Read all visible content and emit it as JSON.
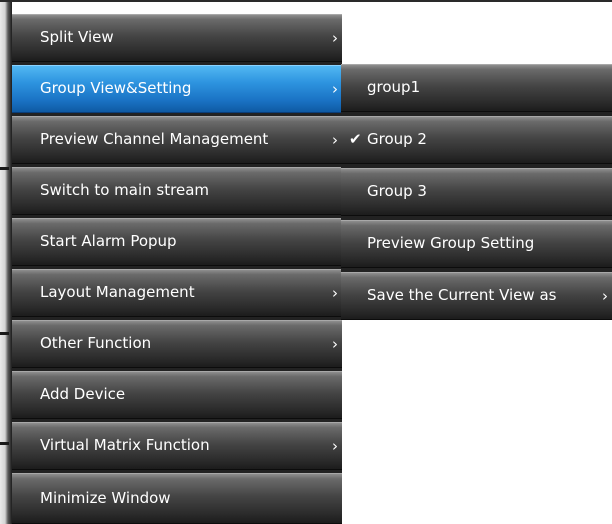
{
  "main_menu": {
    "items": [
      {
        "label": "Split View",
        "has_submenu": true
      },
      {
        "label": "Group View&Setting",
        "has_submenu": true,
        "selected": true
      },
      {
        "label": "Preview Channel Management",
        "has_submenu": true
      },
      {
        "label": "Switch to main stream",
        "has_submenu": false
      },
      {
        "label": "Start Alarm Popup",
        "has_submenu": false
      },
      {
        "label": "Layout Management",
        "has_submenu": true
      },
      {
        "label": "Other Function",
        "has_submenu": true
      },
      {
        "label": "Add Device",
        "has_submenu": false
      },
      {
        "label": "Virtual Matrix Function",
        "has_submenu": true
      },
      {
        "label": "Minimize Window",
        "has_submenu": false
      }
    ]
  },
  "sub_menu": {
    "items": [
      {
        "label": "group1",
        "checked": false,
        "has_submenu": false
      },
      {
        "label": "Group 2",
        "checked": true,
        "has_submenu": false
      },
      {
        "label": "Group 3",
        "checked": false,
        "has_submenu": false
      },
      {
        "label": "Preview Group Setting",
        "checked": false,
        "has_submenu": false
      },
      {
        "label": "Save the Current View as",
        "checked": false,
        "has_submenu": true
      }
    ]
  },
  "glyphs": {
    "submenu_arrow": "›",
    "check_mark": "✔"
  },
  "colors": {
    "item_background": "#3a3a3a",
    "selected_background": "#1f7fd0",
    "text": "#ffffff"
  }
}
